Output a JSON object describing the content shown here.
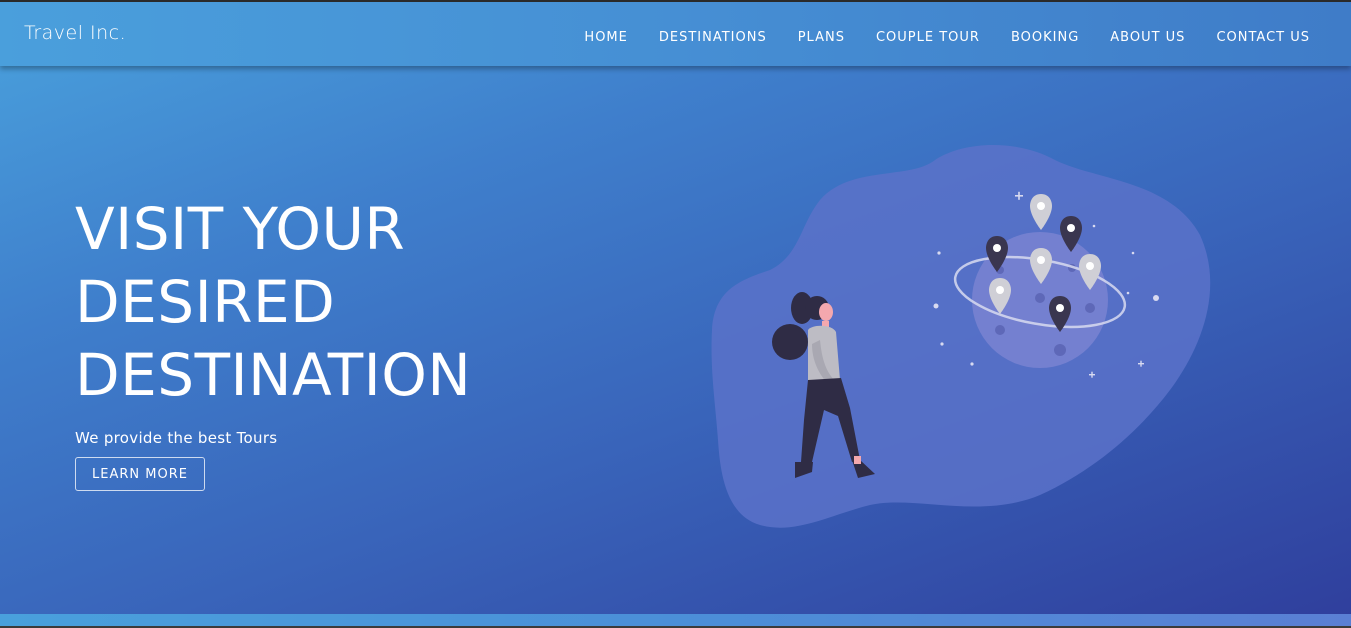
{
  "brand": {
    "name": "Travel Inc."
  },
  "nav": {
    "items": [
      {
        "label": "HOME"
      },
      {
        "label": "DESTINATIONS"
      },
      {
        "label": "PLANS"
      },
      {
        "label": "COUPLE TOUR"
      },
      {
        "label": "BOOKING"
      },
      {
        "label": "ABOUT US"
      },
      {
        "label": "CONTACT US"
      }
    ]
  },
  "hero": {
    "title_lines": [
      "VISIT YOUR",
      "DESIRED",
      "DESTINATION"
    ],
    "tagline": "We provide the best Tours",
    "button_label": "LEARN MORE"
  },
  "colors": {
    "gradient_start": "#4aa2dd",
    "gradient_end": "#2f3e9c",
    "blob": "#5a72c9",
    "planet": "#7480d0",
    "pin_dark": "#3a3650",
    "pin_light": "#cfcfd6"
  }
}
